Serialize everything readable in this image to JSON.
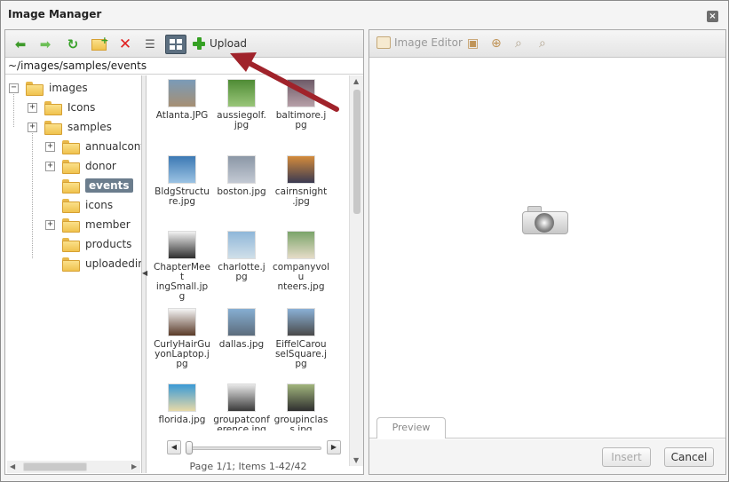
{
  "window": {
    "title": "Image Manager",
    "close_label": "×"
  },
  "toolbar": {
    "buttons": [
      {
        "name": "back-button",
        "icon": "arrow-left-icon"
      },
      {
        "name": "forward-button",
        "icon": "arrow-right-icon"
      },
      {
        "name": "refresh-button",
        "icon": "refresh-icon"
      },
      {
        "name": "new-folder-button",
        "icon": "new-folder-icon"
      },
      {
        "name": "delete-button",
        "icon": "delete-icon"
      },
      {
        "name": "list-view-button",
        "icon": "list-view-icon"
      },
      {
        "name": "thumbnail-view-button",
        "icon": "thumbnail-view-icon",
        "selected": true
      }
    ],
    "upload_label": "Upload"
  },
  "path": "~/images/samples/events",
  "tree": [
    {
      "label": "images",
      "level": 0,
      "expander": "−"
    },
    {
      "label": "Icons",
      "level": 1,
      "expander": "+"
    },
    {
      "label": "samples",
      "level": 1,
      "expander": "+"
    },
    {
      "label": "annualconfe",
      "level": 2,
      "expander": "+"
    },
    {
      "label": "donor",
      "level": 2,
      "expander": "+"
    },
    {
      "label": "events",
      "level": 2,
      "expander": "",
      "selected": true
    },
    {
      "label": "icons",
      "level": 2,
      "expander": ""
    },
    {
      "label": "member",
      "level": 2,
      "expander": "+"
    },
    {
      "label": "products",
      "level": 2,
      "expander": ""
    },
    {
      "label": "uploadedim",
      "level": 2,
      "expander": ""
    }
  ],
  "files": [
    {
      "name": "Atlanta.JPG",
      "colors": [
        "#7a9bb8",
        "#a68f73"
      ]
    },
    {
      "name": "aussiegolf.jpg",
      "colors": [
        "#4f8b35",
        "#9ac67a"
      ]
    },
    {
      "name": "baltimore.jpg",
      "colors": [
        "#6e5b68",
        "#b7a0a8"
      ]
    },
    {
      "name": "BldgStructure.jpg",
      "colors": [
        "#3c79b4",
        "#9cc3e3"
      ]
    },
    {
      "name": "boston.jpg",
      "colors": [
        "#8b97a6",
        "#c3c9d3"
      ]
    },
    {
      "name": "cairnsnight.jpg",
      "colors": [
        "#d48b3b",
        "#3b3a52"
      ]
    },
    {
      "name": "ChapterMeetingSmall.jpg",
      "colors": [
        "#f2f2f2",
        "#2d2d2d"
      ]
    },
    {
      "name": "charlotte.jpg",
      "colors": [
        "#8fb7d9",
        "#d0dfe9"
      ]
    },
    {
      "name": "companyvolunteers.jpg",
      "colors": [
        "#7ba46a",
        "#e6dcc8"
      ]
    },
    {
      "name": "CurlyHairGuyonLaptop.jpg",
      "colors": [
        "#f5f5f5",
        "#5a3a28"
      ]
    },
    {
      "name": "dallas.jpg",
      "colors": [
        "#86aed2",
        "#5c6c7c"
      ]
    },
    {
      "name": "EiffelCarouselSquare.jpg",
      "colors": [
        "#8ab0d6",
        "#4a4a4a"
      ]
    },
    {
      "name": "florida.jpg",
      "colors": [
        "#3a9ad6",
        "#e7d9a7"
      ]
    },
    {
      "name": "groupatconference.jpg",
      "colors": [
        "#e8e8e8",
        "#3a3a3a"
      ]
    },
    {
      "name": "groupinclass.jpg",
      "colors": [
        "#a1b57c",
        "#2f2f2f"
      ]
    }
  ],
  "pager": "Page 1/1; Items 1-42/42",
  "preview_toolbar": {
    "image_editor_label": "Image Editor",
    "icons": [
      "best-fit-icon",
      "actual-size-icon",
      "zoom-in-icon",
      "zoom-out-icon"
    ]
  },
  "preview_tab": "Preview",
  "buttons": {
    "insert": "Insert",
    "cancel": "Cancel"
  },
  "colors": {
    "arrow": "#a0232b",
    "accent_green": "#35a023",
    "selection": "#6b7d8d"
  }
}
